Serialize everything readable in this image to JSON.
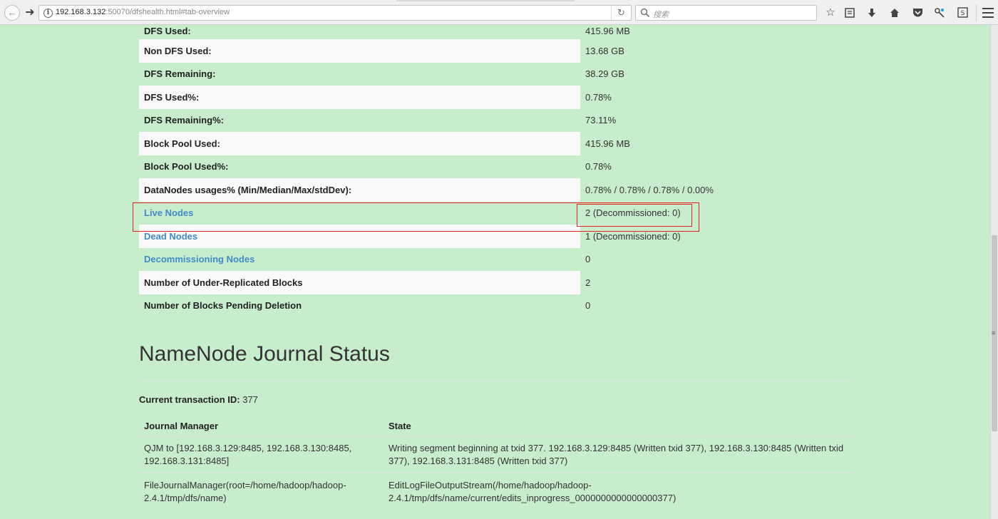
{
  "browser": {
    "url_host": "192.168.3.132",
    "url_rest": ":50070/dfshealth.html#tab-overview",
    "search_placeholder": "搜索",
    "icons": [
      "back-icon",
      "forward-icon",
      "info-icon",
      "reload-icon",
      "search-icon",
      "bookmark-star-icon",
      "reading-list-icon",
      "download-icon",
      "home-icon",
      "pocket-icon",
      "tools-icon",
      "screenshot-icon",
      "menu-icon"
    ]
  },
  "summary": [
    {
      "label": "DFS Used:",
      "value": "415.96 MB",
      "link": false
    },
    {
      "label": "Non DFS Used:",
      "value": "13.68 GB",
      "link": false
    },
    {
      "label": "DFS Remaining:",
      "value": "38.29 GB",
      "link": false
    },
    {
      "label": "DFS Used%:",
      "value": "0.78%",
      "link": false
    },
    {
      "label": "DFS Remaining%:",
      "value": "73.11%",
      "link": false
    },
    {
      "label": "Block Pool Used:",
      "value": "415.96 MB",
      "link": false
    },
    {
      "label": "Block Pool Used%:",
      "value": "0.78%",
      "link": false
    },
    {
      "label": "DataNodes usages% (Min/Median/Max/stdDev):",
      "value": "0.78% / 0.78% / 0.78% / 0.00%",
      "link": false
    },
    {
      "label": "Live Nodes",
      "value": "2 (Decommissioned: 0)",
      "link": true
    },
    {
      "label": "Dead Nodes",
      "value": "1 (Decommissioned: 0)",
      "link": true
    },
    {
      "label": "Decommissioning Nodes",
      "value": "0",
      "link": true
    },
    {
      "label": "Number of Under-Replicated Blocks",
      "value": "2",
      "link": false
    },
    {
      "label": "Number of Blocks Pending Deletion",
      "value": "0",
      "link": false
    }
  ],
  "journal": {
    "title": "NameNode Journal Status",
    "txid_label": "Current transaction ID:",
    "txid_value": "377",
    "headers": {
      "manager": "Journal Manager",
      "state": "State"
    },
    "rows": [
      {
        "manager": "QJM to [192.168.3.129:8485, 192.168.3.130:8485, 192.168.3.131:8485]",
        "state": "Writing segment beginning at txid 377. 192.168.3.129:8485 (Written txid 377), 192.168.3.130:8485 (Written txid 377), 192.168.3.131:8485 (Written txid 377)"
      },
      {
        "manager": "FileJournalManager(root=/home/hadoop/hadoop-2.4.1/tmp/dfs/name)",
        "state": "EditLogFileOutputStream(/home/hadoop/hadoop-2.4.1/tmp/dfs/name/current/edits_inprogress_0000000000000000377)"
      }
    ]
  },
  "colors": {
    "page_bg": "#c7edcc",
    "link": "#428bca",
    "annotation": "#e0231f",
    "stripe": "#f9f9f9"
  }
}
